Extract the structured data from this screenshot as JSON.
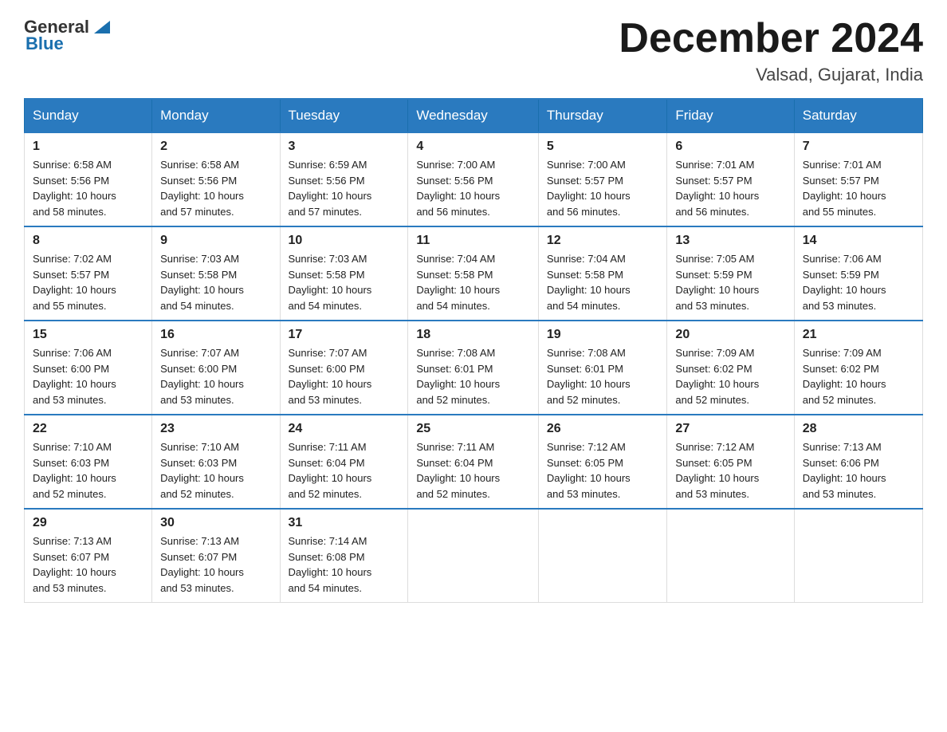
{
  "header": {
    "logo_general": "General",
    "logo_blue": "Blue",
    "month_title": "December 2024",
    "location": "Valsad, Gujarat, India"
  },
  "weekdays": [
    "Sunday",
    "Monday",
    "Tuesday",
    "Wednesday",
    "Thursday",
    "Friday",
    "Saturday"
  ],
  "weeks": [
    [
      {
        "day": "1",
        "info": "Sunrise: 6:58 AM\nSunset: 5:56 PM\nDaylight: 10 hours\nand 58 minutes."
      },
      {
        "day": "2",
        "info": "Sunrise: 6:58 AM\nSunset: 5:56 PM\nDaylight: 10 hours\nand 57 minutes."
      },
      {
        "day": "3",
        "info": "Sunrise: 6:59 AM\nSunset: 5:56 PM\nDaylight: 10 hours\nand 57 minutes."
      },
      {
        "day": "4",
        "info": "Sunrise: 7:00 AM\nSunset: 5:56 PM\nDaylight: 10 hours\nand 56 minutes."
      },
      {
        "day": "5",
        "info": "Sunrise: 7:00 AM\nSunset: 5:57 PM\nDaylight: 10 hours\nand 56 minutes."
      },
      {
        "day": "6",
        "info": "Sunrise: 7:01 AM\nSunset: 5:57 PM\nDaylight: 10 hours\nand 56 minutes."
      },
      {
        "day": "7",
        "info": "Sunrise: 7:01 AM\nSunset: 5:57 PM\nDaylight: 10 hours\nand 55 minutes."
      }
    ],
    [
      {
        "day": "8",
        "info": "Sunrise: 7:02 AM\nSunset: 5:57 PM\nDaylight: 10 hours\nand 55 minutes."
      },
      {
        "day": "9",
        "info": "Sunrise: 7:03 AM\nSunset: 5:58 PM\nDaylight: 10 hours\nand 54 minutes."
      },
      {
        "day": "10",
        "info": "Sunrise: 7:03 AM\nSunset: 5:58 PM\nDaylight: 10 hours\nand 54 minutes."
      },
      {
        "day": "11",
        "info": "Sunrise: 7:04 AM\nSunset: 5:58 PM\nDaylight: 10 hours\nand 54 minutes."
      },
      {
        "day": "12",
        "info": "Sunrise: 7:04 AM\nSunset: 5:58 PM\nDaylight: 10 hours\nand 54 minutes."
      },
      {
        "day": "13",
        "info": "Sunrise: 7:05 AM\nSunset: 5:59 PM\nDaylight: 10 hours\nand 53 minutes."
      },
      {
        "day": "14",
        "info": "Sunrise: 7:06 AM\nSunset: 5:59 PM\nDaylight: 10 hours\nand 53 minutes."
      }
    ],
    [
      {
        "day": "15",
        "info": "Sunrise: 7:06 AM\nSunset: 6:00 PM\nDaylight: 10 hours\nand 53 minutes."
      },
      {
        "day": "16",
        "info": "Sunrise: 7:07 AM\nSunset: 6:00 PM\nDaylight: 10 hours\nand 53 minutes."
      },
      {
        "day": "17",
        "info": "Sunrise: 7:07 AM\nSunset: 6:00 PM\nDaylight: 10 hours\nand 53 minutes."
      },
      {
        "day": "18",
        "info": "Sunrise: 7:08 AM\nSunset: 6:01 PM\nDaylight: 10 hours\nand 52 minutes."
      },
      {
        "day": "19",
        "info": "Sunrise: 7:08 AM\nSunset: 6:01 PM\nDaylight: 10 hours\nand 52 minutes."
      },
      {
        "day": "20",
        "info": "Sunrise: 7:09 AM\nSunset: 6:02 PM\nDaylight: 10 hours\nand 52 minutes."
      },
      {
        "day": "21",
        "info": "Sunrise: 7:09 AM\nSunset: 6:02 PM\nDaylight: 10 hours\nand 52 minutes."
      }
    ],
    [
      {
        "day": "22",
        "info": "Sunrise: 7:10 AM\nSunset: 6:03 PM\nDaylight: 10 hours\nand 52 minutes."
      },
      {
        "day": "23",
        "info": "Sunrise: 7:10 AM\nSunset: 6:03 PM\nDaylight: 10 hours\nand 52 minutes."
      },
      {
        "day": "24",
        "info": "Sunrise: 7:11 AM\nSunset: 6:04 PM\nDaylight: 10 hours\nand 52 minutes."
      },
      {
        "day": "25",
        "info": "Sunrise: 7:11 AM\nSunset: 6:04 PM\nDaylight: 10 hours\nand 52 minutes."
      },
      {
        "day": "26",
        "info": "Sunrise: 7:12 AM\nSunset: 6:05 PM\nDaylight: 10 hours\nand 53 minutes."
      },
      {
        "day": "27",
        "info": "Sunrise: 7:12 AM\nSunset: 6:05 PM\nDaylight: 10 hours\nand 53 minutes."
      },
      {
        "day": "28",
        "info": "Sunrise: 7:13 AM\nSunset: 6:06 PM\nDaylight: 10 hours\nand 53 minutes."
      }
    ],
    [
      {
        "day": "29",
        "info": "Sunrise: 7:13 AM\nSunset: 6:07 PM\nDaylight: 10 hours\nand 53 minutes."
      },
      {
        "day": "30",
        "info": "Sunrise: 7:13 AM\nSunset: 6:07 PM\nDaylight: 10 hours\nand 53 minutes."
      },
      {
        "day": "31",
        "info": "Sunrise: 7:14 AM\nSunset: 6:08 PM\nDaylight: 10 hours\nand 54 minutes."
      },
      null,
      null,
      null,
      null
    ]
  ]
}
